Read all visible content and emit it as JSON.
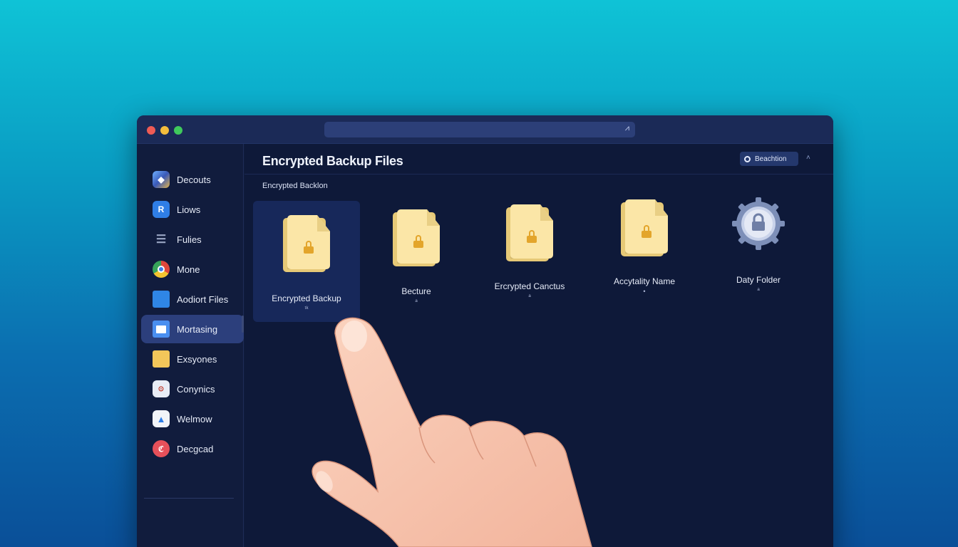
{
  "sidebar": {
    "items": [
      {
        "label": "Decouts",
        "icon": "cube-icon",
        "color": "#3f74c9"
      },
      {
        "label": "Liows",
        "icon": "app-icon",
        "color": "#2f7ee6"
      },
      {
        "label": "Fulies",
        "icon": "list-icon",
        "color": "#8a96b4"
      },
      {
        "label": "Mone",
        "icon": "chrome-icon",
        "color": "#e0483c"
      },
      {
        "label": "Aodiort Files",
        "icon": "folder-icon",
        "color": "#2f86e6"
      },
      {
        "label": "Mortasing",
        "icon": "folder-icon",
        "color": "#4a8ff0",
        "active": true
      },
      {
        "label": "Exsyones",
        "icon": "folder-icon",
        "color": "#f2c65a"
      },
      {
        "label": "Conynics",
        "icon": "document-icon",
        "color": "#e8ecf5"
      },
      {
        "label": "Welmow",
        "icon": "drive-icon",
        "color": "#f2f4f8"
      },
      {
        "label": "Decgcad",
        "icon": "circle-icon",
        "color": "#e6505a"
      }
    ]
  },
  "main": {
    "title": "Encrypted Backup Files",
    "section_label": "Encrypted Backlon",
    "filter_label": "Beachtion",
    "files": [
      {
        "name": "Encrypted Backup",
        "sub": "ᵗᵏ",
        "type": "locked-folder",
        "selected": true
      },
      {
        "name": "Becture",
        "sub": "ᵃ",
        "type": "locked-folder"
      },
      {
        "name": "Ercrypted Canctus",
        "sub": "ᵃ",
        "type": "locked-folder"
      },
      {
        "name": "Accytality Name",
        "sub": "•",
        "type": "locked-folder"
      },
      {
        "name": "Daty Folder",
        "sub": "ᵃ",
        "type": "gear-lock"
      }
    ]
  },
  "colors": {
    "window_bg": "#0f1b3c",
    "titlebar": "#1b2a57",
    "accent_active": "#2c3f7c",
    "folder": "#fbe6a7",
    "lock": "#e3a52b"
  }
}
